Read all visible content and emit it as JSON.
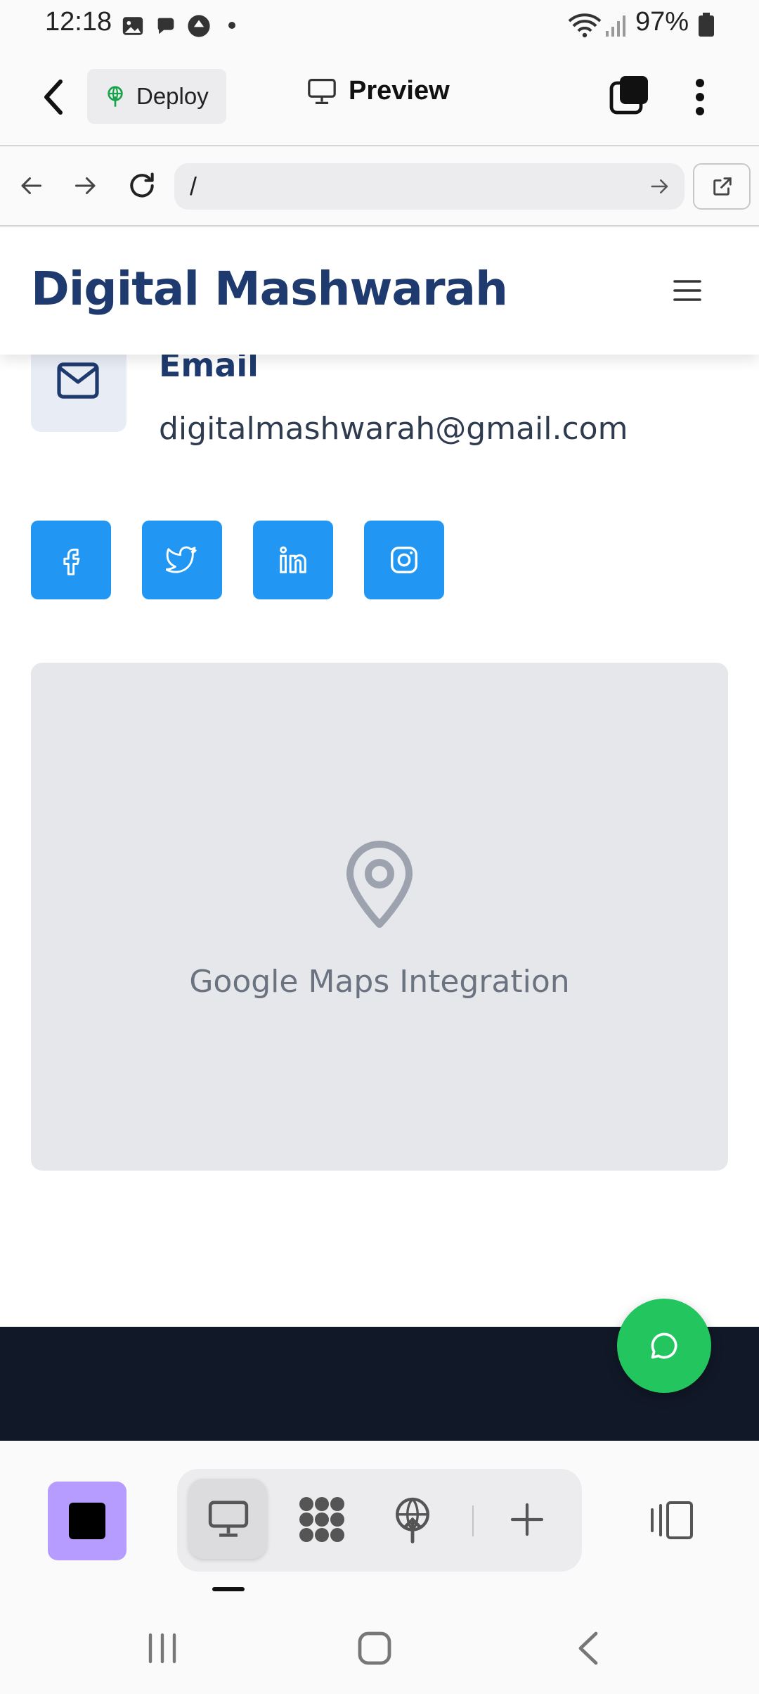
{
  "status_bar": {
    "time": "12:18",
    "battery": "97%",
    "icons": [
      "gallery-icon",
      "chat-bubble-icon",
      "upload-icon",
      "dot-icon",
      "wifi-icon",
      "signal-icon",
      "battery-icon"
    ]
  },
  "toolbar": {
    "deploy_label": "Deploy",
    "preview_label": "Preview"
  },
  "browser": {
    "url": "/"
  },
  "site": {
    "brand": "Digital Mashwarah",
    "contact": {
      "email_heading": "Email",
      "email_value": "digitalmashwarah@gmail.com"
    },
    "social_links": [
      "facebook",
      "twitter",
      "linkedin",
      "instagram"
    ],
    "map_label": "Google Maps Integration"
  },
  "colors": {
    "brand_navy": "#1e3a6e",
    "social_blue": "#2196f3",
    "fab_green": "#22c55e",
    "footer_dark": "#111827",
    "project_purple": "#b69cff"
  }
}
